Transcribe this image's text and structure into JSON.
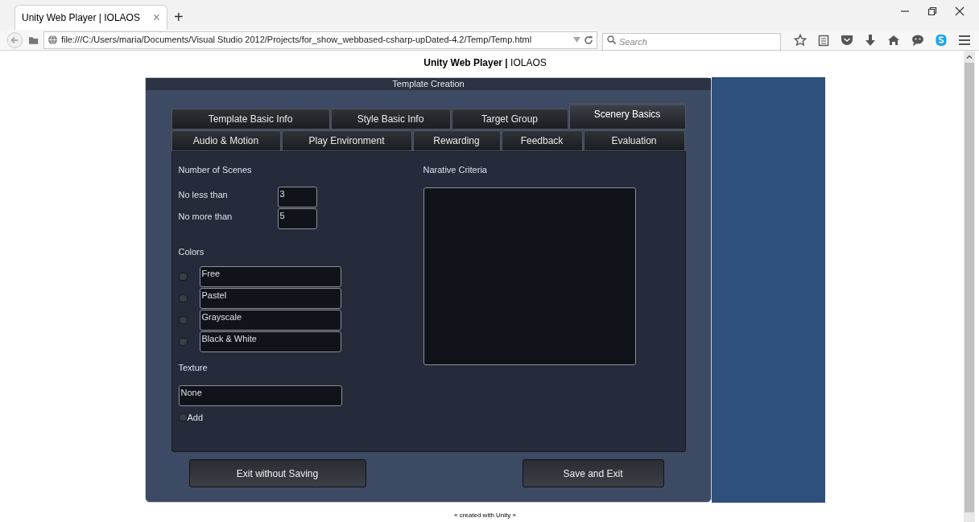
{
  "browser": {
    "tab_title": "Unity Web Player | IOLAOS",
    "tab_close": "×",
    "new_tab": "+",
    "url": "file:///C:/Users/maria/Documents/Visual Studio 2012/Projects/for_show_webbased-csharp-upDated-4.2/Temp/Temp.html",
    "search_placeholder": "Search"
  },
  "page_header": "**Unity Web Player |** IOLAOS",
  "dialog": {
    "title": "Template Creation",
    "tab_rows": [
      [
        {
          "label": "Template Basic Info",
          "selected": false
        },
        {
          "label": "Style Basic Info",
          "selected": false
        },
        {
          "label": "Target Group",
          "selected": false
        },
        {
          "label": "Scenery Basics",
          "selected": true
        }
      ],
      [
        {
          "label": "Audio & Motion",
          "selected": false
        },
        {
          "label": "Play Environment",
          "selected": false
        },
        {
          "label": "Rewarding",
          "selected": false
        },
        {
          "label": "Feedback",
          "selected": false
        },
        {
          "label": "Evaluation",
          "selected": false
        }
      ]
    ],
    "scenes": {
      "label": "Number of Scenes",
      "fields": [
        {
          "label": "No less than",
          "value": "3"
        },
        {
          "label": "No more than",
          "value": "5"
        }
      ]
    },
    "colors": {
      "label": "Colors",
      "options": [
        {
          "value": "Free",
          "checked": false
        },
        {
          "value": "Pastel",
          "checked": false
        },
        {
          "value": "Grayscale",
          "checked": false
        },
        {
          "value": "Black & White",
          "checked": false
        }
      ]
    },
    "texture": {
      "label": "Texture",
      "value": "None",
      "add": {
        "label": "Add",
        "checked": false
      }
    },
    "narrative": {
      "label": "Narative Criteria"
    },
    "buttons": [
      "Exit without Saving",
      "Save and Exit"
    ]
  },
  "footer": "« created with Unity »"
}
